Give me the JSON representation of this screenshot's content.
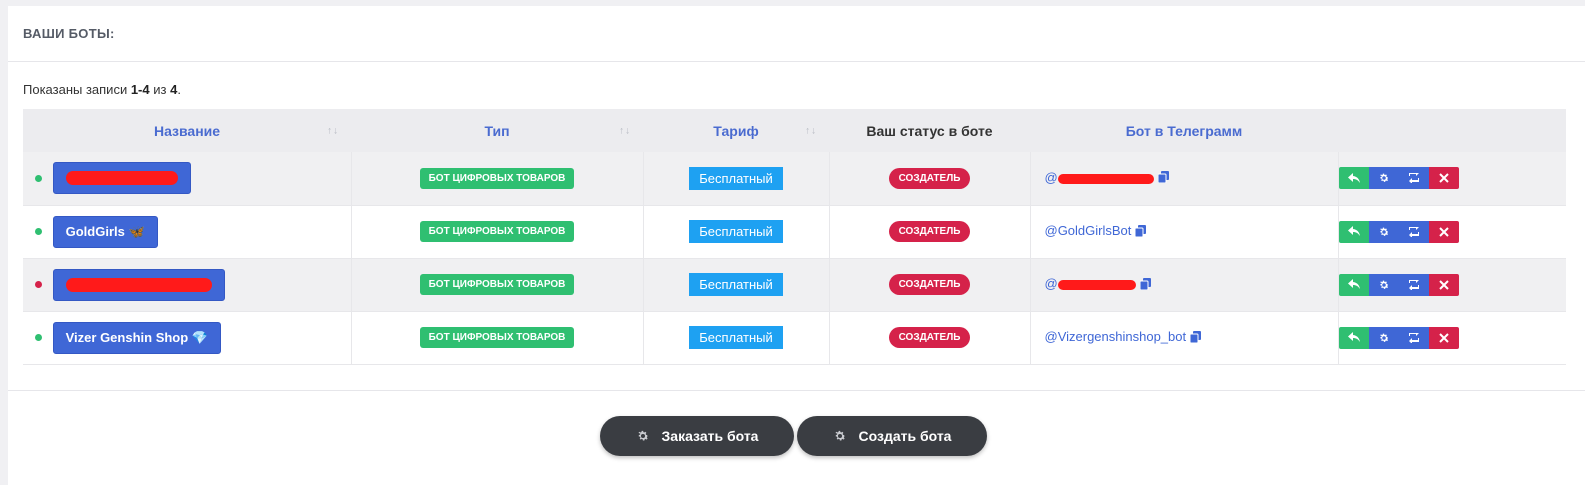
{
  "card": {
    "title": "ВАШИ БОТЫ:"
  },
  "summary": {
    "prefix": "Показаны записи ",
    "range": "1-4",
    "middle": " из ",
    "total": "4",
    "suffix": "."
  },
  "table": {
    "columns": [
      "Название",
      "Тип",
      "Тариф",
      "Ваш статус в боте",
      "Бот в Телеграмм",
      ""
    ],
    "sort_glyph": "↑↓",
    "rows": [
      {
        "name": "",
        "emoji": "",
        "status_color": "#2fbf71",
        "type": "БОТ ЦИФРОВЫХ ТОВАРОВ",
        "tariff": "Бесплатный",
        "role": "СОЗДАТЕЛЬ",
        "telegram": "@"
      },
      {
        "name": "GoldGirls",
        "emoji": "🦋",
        "status_color": "#2fbf71",
        "type": "БОТ ЦИФРОВЫХ ТОВАРОВ",
        "tariff": "Бесплатный",
        "role": "СОЗДАТЕЛЬ",
        "telegram": "@GoldGirlsBot"
      },
      {
        "name": "",
        "emoji": "",
        "status_color": "#d5224a",
        "type": "БОТ ЦИФРОВЫХ ТОВАРОВ",
        "tariff": "Бесплатный",
        "role": "СОЗДАТЕЛЬ",
        "telegram": "@"
      },
      {
        "name": "Vizer Genshin Shop",
        "emoji": "💎",
        "status_color": "#2fbf71",
        "type": "БОТ ЦИФРОВЫХ ТОВАРОВ",
        "tariff": "Бесплатный",
        "role": "СОЗДАТЕЛЬ",
        "telegram": "@Vizergenshinshop_bot"
      }
    ]
  },
  "buttons": {
    "order": "Заказать бота",
    "create": "Создать бота"
  },
  "colors": {
    "accent_blue": "#3f67d6",
    "green": "#2fbf71",
    "red": "#d5224a",
    "tariff_blue": "#1ea1f2",
    "dark_button": "#3a3d42"
  },
  "icons": {
    "copy": "copy-icon",
    "reply": "reply-icon",
    "settings": "gear-icon",
    "retweet": "retweet-icon",
    "delete": "close-icon",
    "button": "gear-icon"
  }
}
